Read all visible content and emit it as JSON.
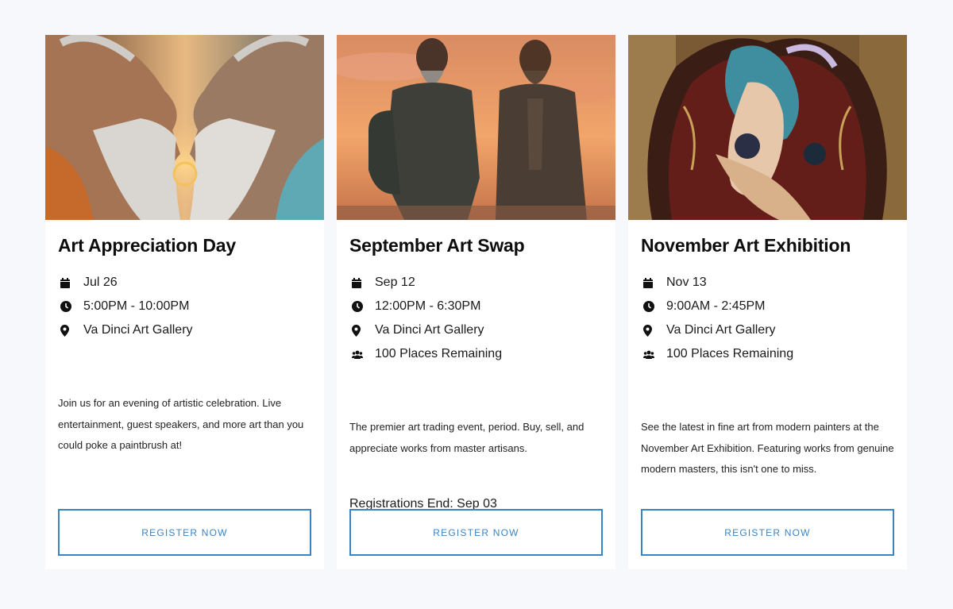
{
  "events": [
    {
      "title": "Art Appreciation Day",
      "date": "Jul 26",
      "time": "5:00PM - 10:00PM",
      "location": "Va Dinci Art Gallery",
      "description": "Join us for an evening of artistic celebration. Live entertainment, guest speakers, and more art than you could poke a paintbrush at!",
      "button": "REGISTER NOW"
    },
    {
      "title": "September Art Swap",
      "date": "Sep 12",
      "time": "12:00PM - 6:30PM",
      "location": "Va Dinci Art Gallery",
      "places": "100 Places Remaining",
      "description": "The premier art trading event, period. Buy, sell, and appreciate works from master artisans.",
      "registration_end": "Registrations End: Sep 03",
      "button": "REGISTER NOW"
    },
    {
      "title": "November Art Exhibition",
      "date": "Nov 13",
      "time": "9:00AM - 2:45PM",
      "location": "Va Dinci Art Gallery",
      "places": "100 Places Remaining",
      "description": "See the latest in fine art from modern painters at the November Art Exhibition. Featuring works from genuine modern masters, this isn't one to miss.",
      "button": "REGISTER NOW"
    }
  ],
  "icons": {
    "date": "calendar-icon",
    "time": "clock-icon",
    "location": "map-pin-icon",
    "places": "people-icon"
  },
  "colors": {
    "accent": "#3b84c4",
    "background": "#f6f8fc",
    "card": "#ffffff"
  }
}
